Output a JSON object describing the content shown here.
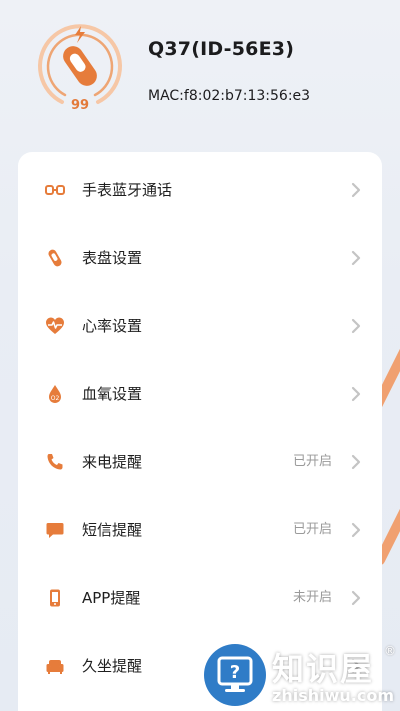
{
  "device": {
    "name": "Q37(ID-56E3)",
    "mac": "MAC:f8:02:b7:13:56:e3",
    "battery": "99",
    "battery_level": 0.99
  },
  "colors": {
    "accent": "#e67c3b",
    "chevron": "#c4c4c4",
    "status_text": "#9a9a9a"
  },
  "menu": {
    "items": [
      {
        "label": "手表蓝牙通话",
        "status": "",
        "icon": "bluetooth-link-icon"
      },
      {
        "label": "表盘设置",
        "status": "",
        "icon": "watch-icon"
      },
      {
        "label": "心率设置",
        "status": "",
        "icon": "heart-rate-icon"
      },
      {
        "label": "血氧设置",
        "status": "",
        "icon": "blood-oxygen-icon"
      },
      {
        "label": "来电提醒",
        "status": "已开启",
        "icon": "phone-icon"
      },
      {
        "label": "短信提醒",
        "status": "已开启",
        "icon": "message-icon"
      },
      {
        "label": "APP提醒",
        "status": "未开启",
        "icon": "app-phone-icon"
      },
      {
        "label": "久坐提醒",
        "status": "",
        "icon": "sofa-icon"
      }
    ]
  },
  "watermark": {
    "title": "知识屋",
    "reg": "®",
    "url": "zhishiwu.com"
  }
}
